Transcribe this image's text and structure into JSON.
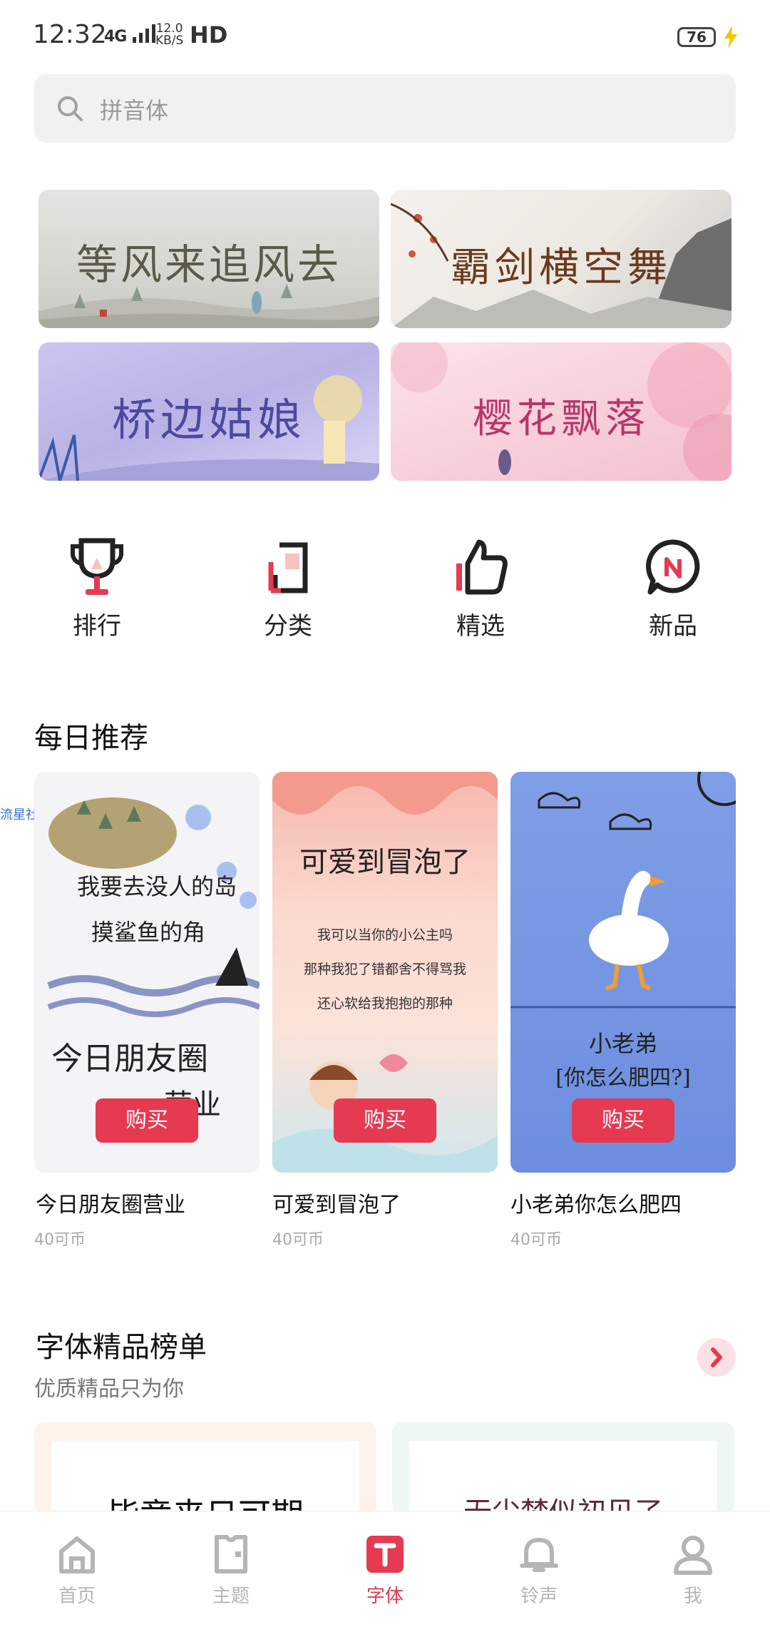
{
  "status_bar": {
    "time": "12:32",
    "network": "4G",
    "speed": "12.0",
    "speed_unit": "KB/S",
    "hd": "HD",
    "battery": "76"
  },
  "search": {
    "placeholder": "拼音体"
  },
  "banners": [
    {
      "title": "等风来追风去",
      "color": "#5a5a48"
    },
    {
      "title": "霸剑横空舞",
      "color": "#6a3a1c"
    },
    {
      "title": "桥边姑娘",
      "color": "#4b4aa0"
    },
    {
      "title": "樱花飘落",
      "color": "#b7366a"
    }
  ],
  "quick_entries": [
    {
      "label": "排行",
      "icon": "trophy-icon"
    },
    {
      "label": "分类",
      "icon": "category-icon"
    },
    {
      "label": "精选",
      "icon": "thumbs-up-icon"
    },
    {
      "label": "新品",
      "icon": "new-badge-icon"
    }
  ],
  "daily": {
    "title": "每日推荐",
    "community_tag": "流星社区",
    "buy_label": "购买",
    "cards": [
      {
        "name": "今日朋友圈营业",
        "price": "40可币",
        "art_lines": [
          "我要去没人的岛",
          "摸鲨鱼的角",
          "今日朋友圈",
          "营业"
        ]
      },
      {
        "name": "可爱到冒泡了",
        "price": "40可币",
        "art_lines": [
          "可爱到冒泡了",
          "我可以当你的小公主吗",
          "那种我犯了错都舍不得骂我",
          "还心软给我抱抱的那种"
        ]
      },
      {
        "name": "小老弟你怎么肥四",
        "price": "40可币",
        "art_lines": [
          "小老弟",
          "[你怎么肥四?]"
        ]
      }
    ]
  },
  "ranking": {
    "title": "字体精品榜单",
    "subtitle": "优质精品只为你",
    "previews": [
      "毕竟来日可期",
      "无尘梦似初见了"
    ]
  },
  "bottom_nav": {
    "items": [
      {
        "label": "首页",
        "icon": "home-icon"
      },
      {
        "label": "主题",
        "icon": "theme-icon"
      },
      {
        "label": "字体",
        "icon": "font-icon"
      },
      {
        "label": "铃声",
        "icon": "bell-icon"
      },
      {
        "label": "我",
        "icon": "profile-icon"
      }
    ],
    "active": "字体"
  },
  "colors": {
    "accent": "#e53a51",
    "search_bg": "#f1f1f1",
    "muted_text": "#a9a9a9"
  }
}
